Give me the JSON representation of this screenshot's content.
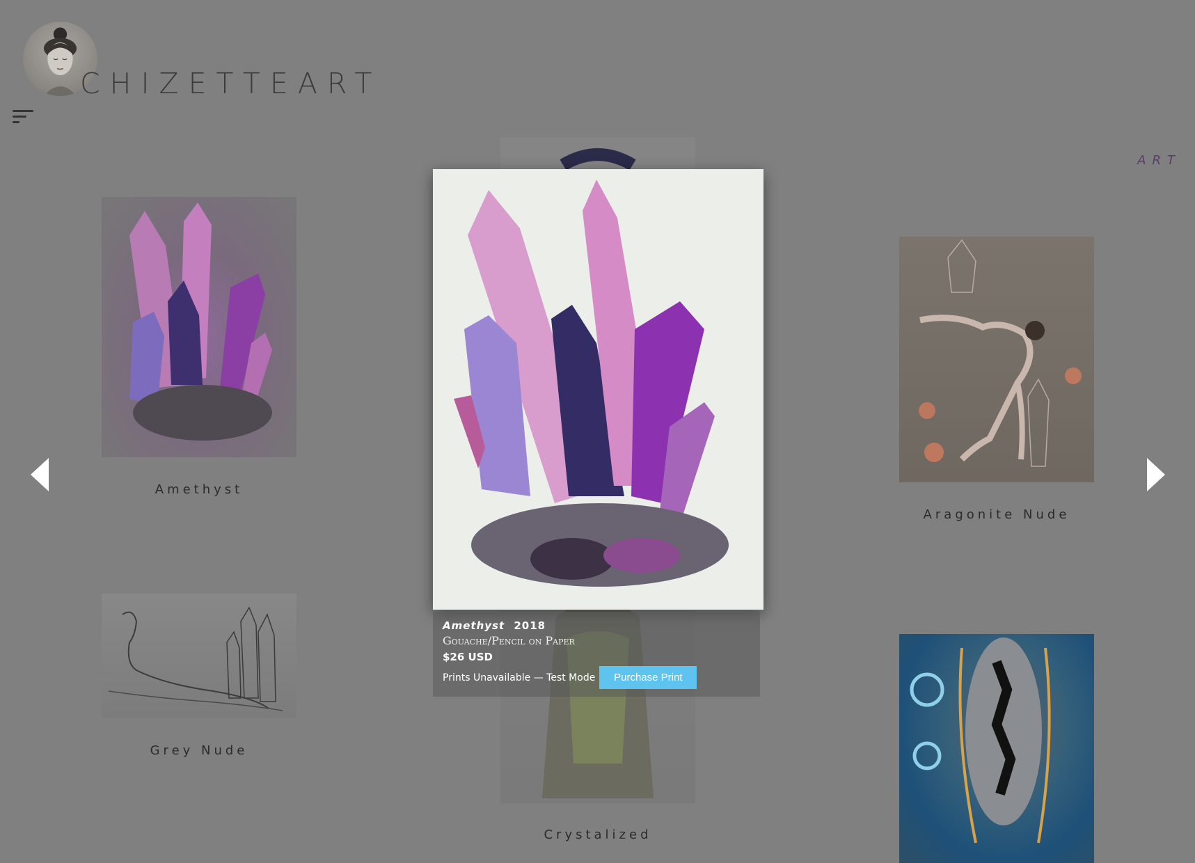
{
  "header": {
    "logo_text": "CHIZETTEART",
    "nav_art": "ART"
  },
  "gallery": [
    {
      "title": "Amethyst"
    },
    {
      "title": "Grey Nude"
    },
    {
      "title": "Aragonite Nude"
    },
    {
      "title": "Crystalized"
    }
  ],
  "lightbox": {
    "title": "Amethyst",
    "year": "2018",
    "medium": "Gouache/Pencil on Paper",
    "price": "$26 USD",
    "availability": "Prints Unavailable — Test Mode",
    "purchase_label": "Purchase Print"
  },
  "colors": {
    "backdrop": "#808080",
    "button": "#5ec3ee",
    "nav_accent": "#5a3d66"
  },
  "icons": {
    "menu": "hamburger-menu-icon",
    "prev": "arrow-left-icon",
    "next": "arrow-right-icon"
  }
}
